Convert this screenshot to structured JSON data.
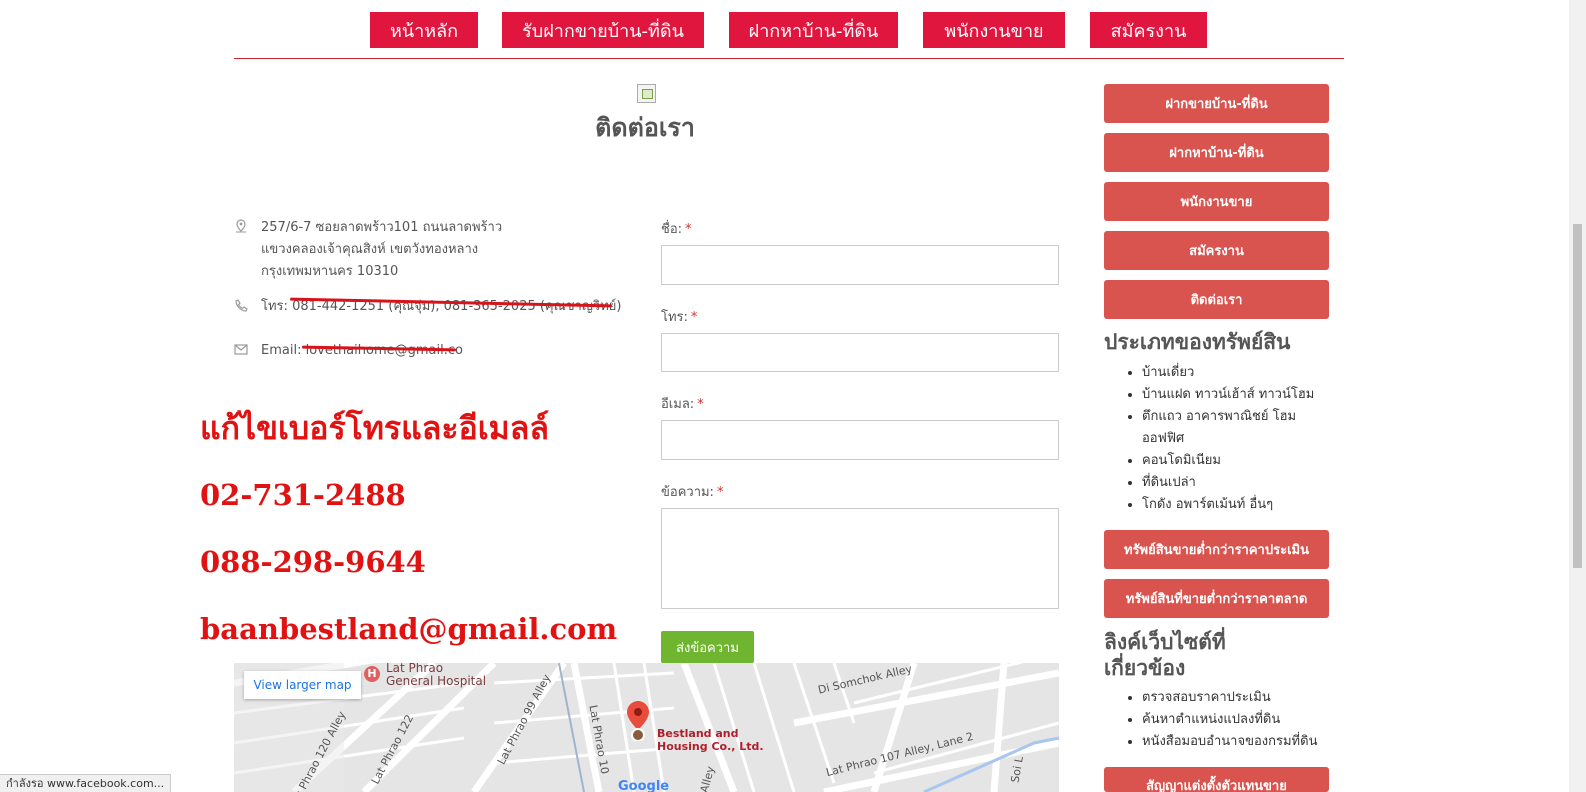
{
  "nav": {
    "items": [
      {
        "label": "หน้าหลัก"
      },
      {
        "label": "รับฝากขายบ้าน-ที่ดิน"
      },
      {
        "label": "ฝากหาบ้าน-ที่ดิน"
      },
      {
        "label": "พนักงานขาย"
      },
      {
        "label": "สมัครงาน"
      }
    ]
  },
  "page_title": "ติดต่อเรา",
  "contact": {
    "address_lines": [
      "257/6-7 ซอยลาดพร้าว101 ถนนลาดพร้าว",
      "แขวงคลองเจ้าคุณสิงห์ เขตวังทองหลาง",
      "กรุงเทพมหานคร 10310"
    ],
    "phone_label": "โทร:",
    "phone_value": "081-442-1251 (คุณจุ๋ม), 081-365-2025 (คุณชาญวิทย์)",
    "email_label": "Email:",
    "email_value": "lovethaihome@gmail.co"
  },
  "correction_note": {
    "heading": "แก้ไขเบอร์โทรและอีเมลล์",
    "phone_1": "02-731-2488",
    "phone_2": "088-298-9644",
    "email": "baanbestland@gmail.com"
  },
  "form": {
    "name_label": "ชื่อ:",
    "phone_label": "โทร:",
    "email_label": "อีเมล:",
    "message_label": "ข้อความ:",
    "required_mark": "*",
    "submit_label": "ส่งข้อความ"
  },
  "map": {
    "view_larger": "View larger map",
    "labels": {
      "hospital": "Lat Phrao\nGeneral Hospital",
      "somchok": "Di Somchok Alley",
      "lp120": "Lat Phrao 120 Alley",
      "lp122": "Lat Phrao 122",
      "lp99": "Lat Phrao 99 Alley",
      "lp10": "Lat Phrao 10",
      "lp107": "Lat Phrao 107 Alley, Lane 2",
      "alley": "Alley",
      "soi": "Soi L",
      "company": "Bestland and\nHousing Co., Ltd.",
      "google": "Google"
    }
  },
  "sidebar": {
    "buttons_top": [
      {
        "label": "ฝากขายบ้าน-ที่ดิน"
      },
      {
        "label": "ฝากหาบ้าน-ที่ดิน"
      },
      {
        "label": "พนักงานขาย"
      },
      {
        "label": "สมัครงาน"
      },
      {
        "label": "ติดต่อเรา"
      }
    ],
    "property_types_heading": "ประเภทของทรัพย์สิน",
    "property_types": [
      "บ้านเดี่ยว",
      "บ้านแฝด ทาวน์เฮ้าส์ ทาวน์โฮม",
      "ตึกแถว อาคารพาณิชย์ โฮม",
      "ออฟฟิศ",
      "คอนโดมิเนียม",
      "ที่ดินเปล่า",
      "โกดัง อพาร์ตเม้นท์ อื่นๆ"
    ],
    "buttons_mid": [
      {
        "label": "ทรัพย์สินขายต่ำกว่าราคาประเมิน"
      },
      {
        "label": "ทรัพย์สินที่ขายต่ำกว่าราคาตลาด"
      }
    ],
    "links_heading_1": "ลิงค์เว็บไซต์ที่",
    "links_heading_2": "เกี่ยวข้อง",
    "links": [
      "ตรวจสอบราคาประเมิน",
      "ค้นหาตำแหน่งแปลงที่ดิน",
      "หนังสือมอบอำนาจของกรมที่ดิน"
    ],
    "bottom_button": "สัญญาแต่งตั้งตัวแทนขาย"
  },
  "status_bar": "กำลังรอ www.facebook.com..."
}
